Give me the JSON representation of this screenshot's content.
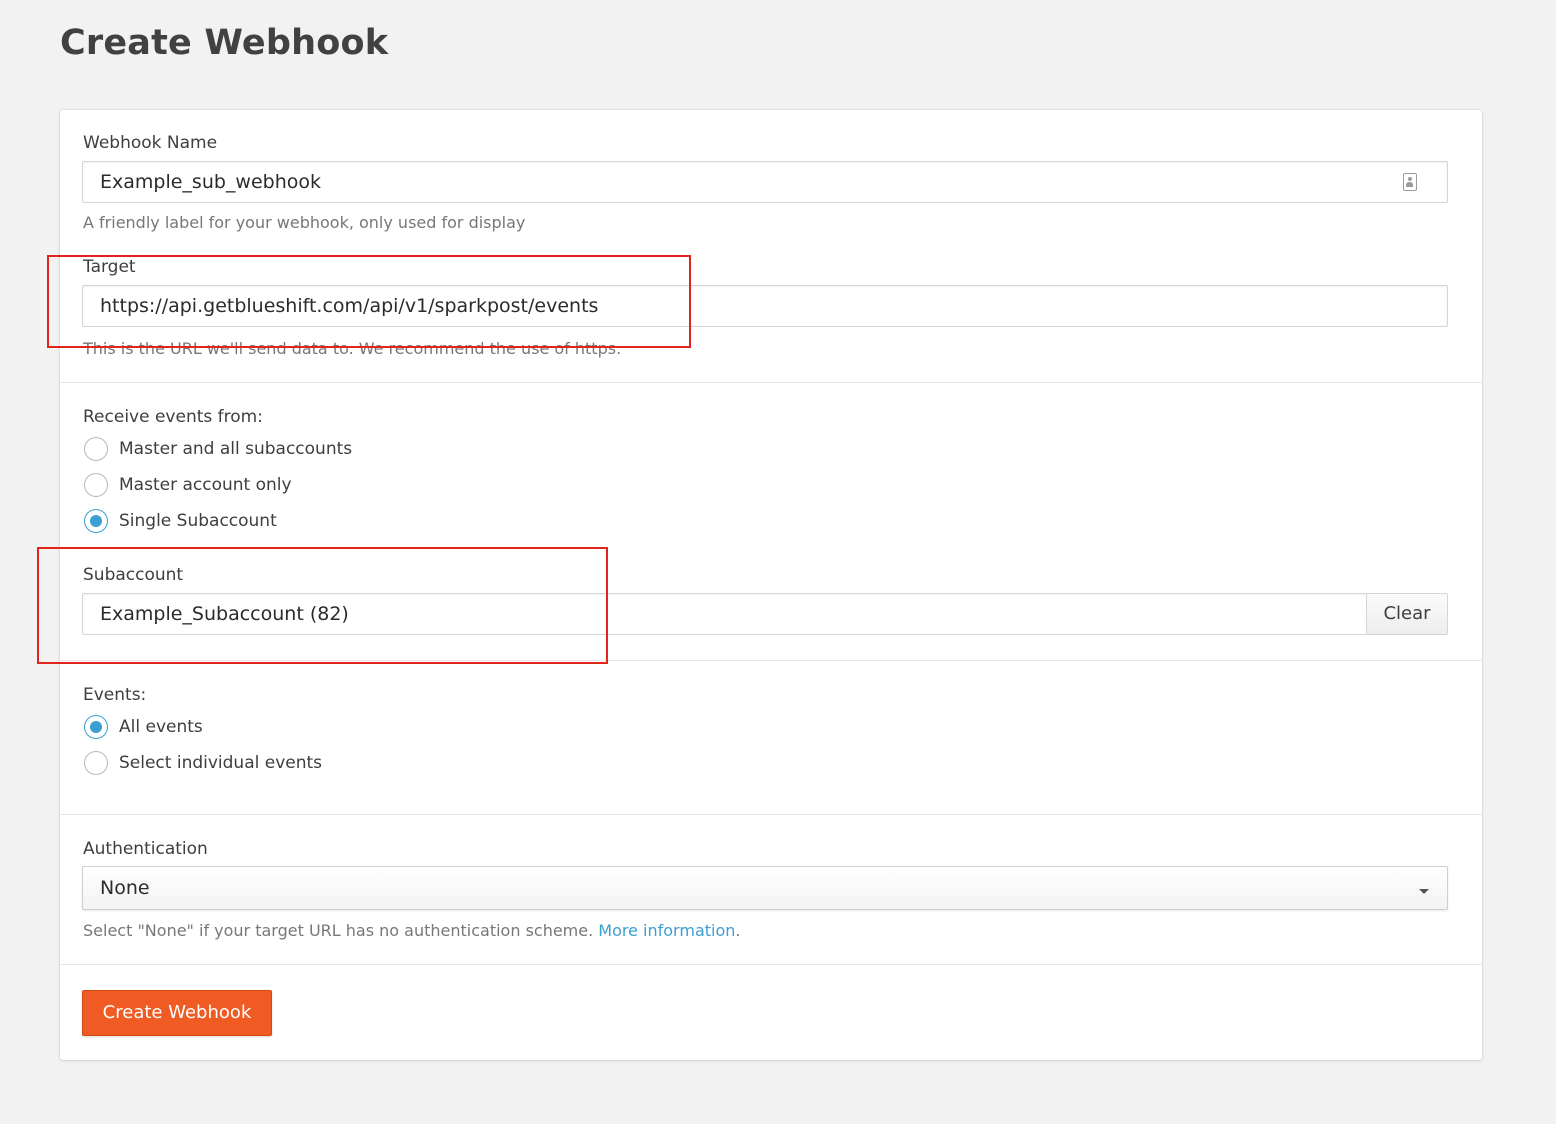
{
  "page": {
    "title": "Create Webhook"
  },
  "form": {
    "webhook_name": {
      "label": "Webhook Name",
      "value": "Example_sub_webhook",
      "help": "A friendly label for your webhook, only used for display",
      "icon": "contact-card-icon"
    },
    "target": {
      "label": "Target",
      "value": "https://api.getblueshift.com/api/v1/sparkpost/events",
      "help": "This is the URL we'll send data to. We recommend the use of https."
    },
    "receive_events": {
      "label": "Receive events from:",
      "options": [
        {
          "label": "Master and all subaccounts",
          "checked": false
        },
        {
          "label": "Master account only",
          "checked": false
        },
        {
          "label": "Single Subaccount",
          "checked": true
        }
      ]
    },
    "subaccount": {
      "label": "Subaccount",
      "value": "Example_Subaccount (82)",
      "clear_label": "Clear"
    },
    "events": {
      "label": "Events:",
      "options": [
        {
          "label": "All events",
          "checked": true
        },
        {
          "label": "Select individual events",
          "checked": false
        }
      ]
    },
    "authentication": {
      "label": "Authentication",
      "selected": "None",
      "help": "Select \"None\" if your target URL has no authentication scheme.",
      "help_link": "More information",
      "help_suffix": "."
    },
    "submit_label": "Create Webhook"
  },
  "colors": {
    "accent_blue": "#3b9fd2",
    "primary_orange": "#f05b23",
    "annotation_red": "#e1251b",
    "page_background": "#f2f2f3"
  }
}
